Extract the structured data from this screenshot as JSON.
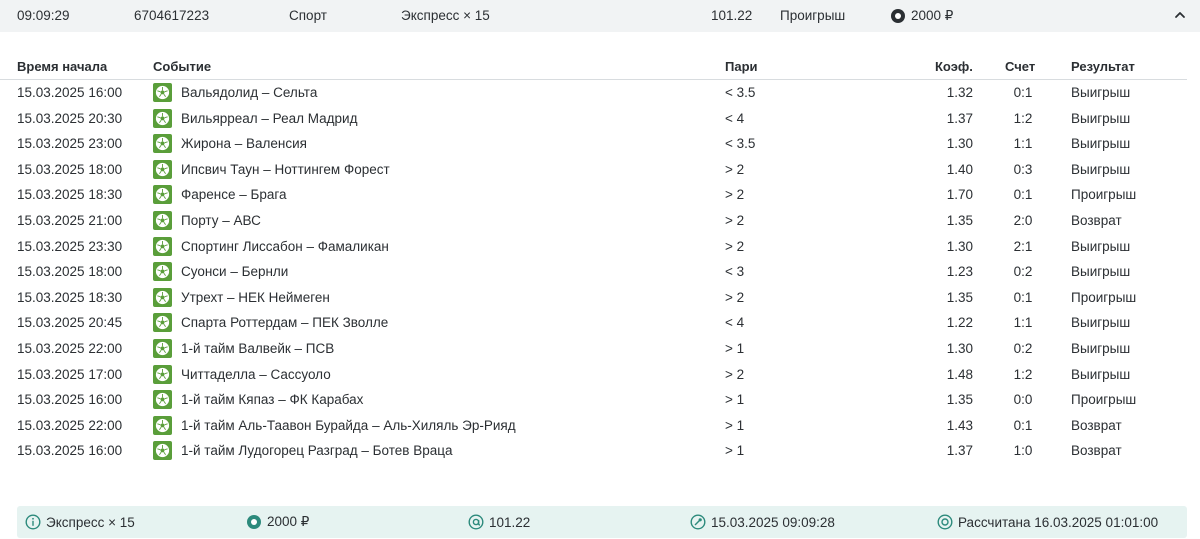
{
  "header": {
    "time": "09:09:29",
    "bet_id": "6704617223",
    "category": "Спорт",
    "bet_type": "Экспресс × 15",
    "total_coef": "101.22",
    "status": "Проигрыш",
    "stake": "2000 ₽",
    "icons": {
      "stake": "coin-icon",
      "collapse": "chevron-up-icon"
    }
  },
  "table": {
    "columns": {
      "start_time": "Время начала",
      "event": "Событие",
      "bet": "Пари",
      "coef": "Коэф.",
      "score": "Счет",
      "result": "Результат"
    },
    "rows": [
      {
        "time": "15.03.2025 16:00",
        "event": "Вальядолид – Сельта",
        "bet": "< 3.5",
        "coef": "1.32",
        "score": "0:1",
        "result": "Выигрыш"
      },
      {
        "time": "15.03.2025 20:30",
        "event": "Вильярреал – Реал Мадрид",
        "bet": "< 4",
        "coef": "1.37",
        "score": "1:2",
        "result": "Выигрыш"
      },
      {
        "time": "15.03.2025 23:00",
        "event": "Жирона – Валенсия",
        "bet": "< 3.5",
        "coef": "1.30",
        "score": "1:1",
        "result": "Выигрыш"
      },
      {
        "time": "15.03.2025 18:00",
        "event": "Ипсвич Таун – Ноттингем Форест",
        "bet": "> 2",
        "coef": "1.40",
        "score": "0:3",
        "result": "Выигрыш"
      },
      {
        "time": "15.03.2025 18:30",
        "event": "Фаренсе – Брага",
        "bet": "> 2",
        "coef": "1.70",
        "score": "0:1",
        "result": "Проигрыш"
      },
      {
        "time": "15.03.2025 21:00",
        "event": "Порту – АВС",
        "bet": "> 2",
        "coef": "1.35",
        "score": "2:0",
        "result": "Возврат"
      },
      {
        "time": "15.03.2025 23:30",
        "event": "Спортинг Лиссабон – Фамаликан",
        "bet": "> 2",
        "coef": "1.30",
        "score": "2:1",
        "result": "Выигрыш"
      },
      {
        "time": "15.03.2025 18:00",
        "event": "Суонси – Бернли",
        "bet": "< 3",
        "coef": "1.23",
        "score": "0:2",
        "result": "Выигрыш"
      },
      {
        "time": "15.03.2025 18:30",
        "event": "Утрехт – НЕК Неймеген",
        "bet": "> 2",
        "coef": "1.35",
        "score": "0:1",
        "result": "Проигрыш"
      },
      {
        "time": "15.03.2025 20:45",
        "event": "Спарта Роттердам – ПЕК Зволле",
        "bet": "< 4",
        "coef": "1.22",
        "score": "1:1",
        "result": "Выигрыш"
      },
      {
        "time": "15.03.2025 22:00",
        "event": "1-й тайм Валвейк – ПСВ",
        "bet": "> 1",
        "coef": "1.30",
        "score": "0:2",
        "result": "Выигрыш"
      },
      {
        "time": "15.03.2025 17:00",
        "event": "Читтаделла – Сассуоло",
        "bet": "> 2",
        "coef": "1.48",
        "score": "1:2",
        "result": "Выигрыш"
      },
      {
        "time": "15.03.2025 16:00",
        "event": "1-й тайм Кяпаз – ФК Карабах",
        "bet": "> 1",
        "coef": "1.35",
        "score": "0:0",
        "result": "Проигрыш"
      },
      {
        "time": "15.03.2025 22:00",
        "event": "1-й тайм Аль-Таавон Бурайда – Аль-Хиляль Эр-Рияд",
        "bet": "> 1",
        "coef": "1.43",
        "score": "0:1",
        "result": "Возврат"
      },
      {
        "time": "15.03.2025 16:00",
        "event": "1-й тайм Лудогорец Разград – Ботев Враца",
        "bet": "> 1",
        "coef": "1.37",
        "score": "1:0",
        "result": "Возврат"
      }
    ],
    "row_icon": "soccer-ball-icon",
    "icon_color": "#5a9e3a"
  },
  "footer": {
    "type": "Экспресс × 15",
    "stake": "2000 ₽",
    "coef": "101.22",
    "placed": "15.03.2025 09:09:28",
    "settled": "Рассчитана 16.03.2025 01:01:00",
    "background": "#e6f3f1",
    "icons": {
      "type": "info-icon",
      "stake": "coin-icon",
      "coef": "at-icon",
      "placed": "pin-icon",
      "settled": "target-icon"
    }
  }
}
